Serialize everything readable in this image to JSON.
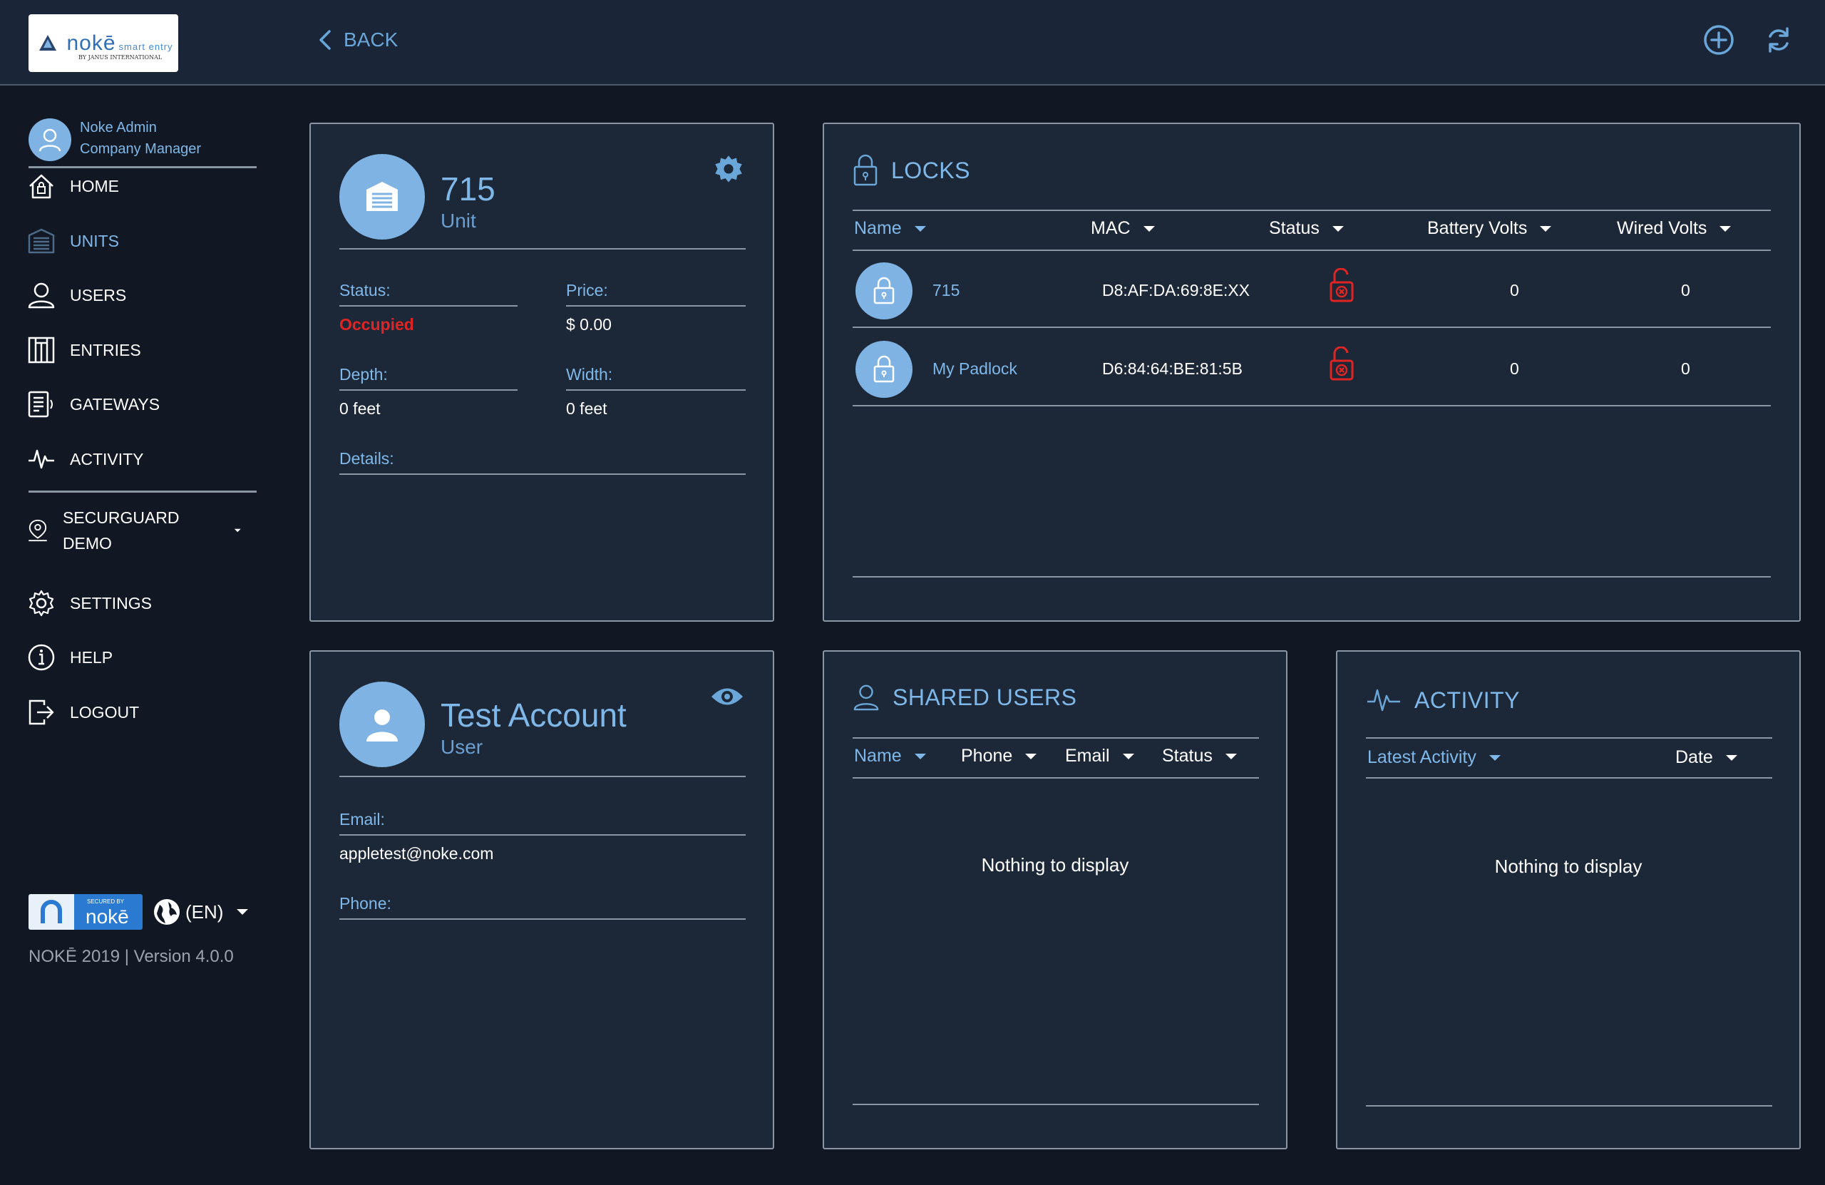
{
  "header": {
    "logo_brand": "nokē",
    "logo_tag": "smart entry",
    "logo_sub": "BY JANUS INTERNATIONAL",
    "back_label": "BACK",
    "accent": "#6aa6d8"
  },
  "sidebar": {
    "profile": {
      "name": "Noke Admin",
      "role": "Company Manager"
    },
    "items": [
      {
        "label": "HOME",
        "icon": "home-lock-icon"
      },
      {
        "label": "UNITS",
        "icon": "garage-door-icon"
      },
      {
        "label": "USERS",
        "icon": "user-icon"
      },
      {
        "label": "ENTRIES",
        "icon": "gate-icon"
      },
      {
        "label": "GATEWAYS",
        "icon": "gateway-icon"
      },
      {
        "label": "ACTIVITY",
        "icon": "pulse-icon"
      }
    ],
    "location": {
      "line1": "SECURGUARD",
      "line2": "DEMO"
    },
    "bottom_items": [
      {
        "label": "SETTINGS",
        "icon": "gear-icon"
      },
      {
        "label": "HELP",
        "icon": "info-icon"
      },
      {
        "label": "LOGOUT",
        "icon": "logout-icon"
      }
    ],
    "secured_small": "SECURED BY",
    "secured_brand": "nokē",
    "language": "(EN)",
    "version": "NOKĒ 2019 | Version 4.0.0"
  },
  "unit_card": {
    "title": "715",
    "subtitle": "Unit",
    "status_label": "Status:",
    "status_value": "Occupied",
    "status_color": "#e02424",
    "price_label": "Price:",
    "price_value": "$ 0.00",
    "depth_label": "Depth:",
    "depth_value": "0 feet",
    "width_label": "Width:",
    "width_value": "0 feet",
    "details_label": "Details:"
  },
  "locks": {
    "title": "LOCKS",
    "columns": [
      "Name",
      "MAC",
      "Status",
      "Battery Volts",
      "Wired Volts"
    ],
    "rows": [
      {
        "name": "715",
        "mac": "D8:AF:DA:69:8E:XX",
        "status": "unlocked-error",
        "battery": "0",
        "wired": "0"
      },
      {
        "name": "My Padlock",
        "mac": "D6:84:64:BE:81:5B",
        "status": "unlocked-error",
        "battery": "0",
        "wired": "0"
      }
    ]
  },
  "user_card": {
    "title": "Test Account",
    "subtitle": "User",
    "email_label": "Email:",
    "email_value": "appletest@noke.com",
    "phone_label": "Phone:"
  },
  "shared_users": {
    "title": "SHARED USERS",
    "columns": [
      "Name",
      "Phone",
      "Email",
      "Status"
    ],
    "empty": "Nothing to display"
  },
  "activity": {
    "title": "ACTIVITY",
    "columns": [
      "Latest Activity",
      "Date"
    ],
    "empty": "Nothing to display"
  }
}
